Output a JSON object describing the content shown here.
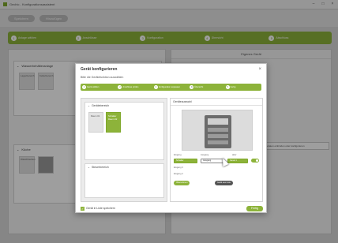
{
  "app": {
    "title": "Gechic - Konfigurationsassistent",
    "toolbar": [
      "Speichern",
      "Hinzufügen"
    ]
  },
  "wizard": {
    "steps": [
      {
        "num": "1",
        "label": "Anlage wählen"
      },
      {
        "num": "2",
        "label": "Anschlüsse"
      },
      {
        "num": "3",
        "label": "Konfiguration"
      },
      {
        "num": "4",
        "label": "Übersicht"
      },
      {
        "num": "5",
        "label": "Abschluss"
      }
    ]
  },
  "background": {
    "left_section1": "Wasserbehälteranlage",
    "left_section1_tiles": [
      "Lagerbereich",
      "Kellerbereich"
    ],
    "left_section2": "Küche",
    "left_section2_tiles": [
      "Waschbecken",
      ""
    ],
    "right_title": "Eigenes Gerät",
    "side_box": "Gerätedaten einbinden oder konfigurieren"
  },
  "dialog": {
    "title": "Gerät konfigurieren",
    "subtitle": "Bitte die Gerätefunktion auswählen",
    "steps": [
      {
        "num": "1",
        "label": "Gerät wählen"
      },
      {
        "num": "2",
        "label": "Anschluss prüfen"
      },
      {
        "num": "3",
        "label": "Konfiguration anpassen"
      },
      {
        "num": "4",
        "label": "Übersicht"
      },
      {
        "num": "5",
        "label": "Fertig"
      }
    ],
    "left_group1_title": "Gerätebereich",
    "left_group1_tiles": [
      {
        "label": "Raum 01"
      },
      {
        "label": "Schalter Raum 02"
      }
    ],
    "left_group2_title": "Steuerbereich",
    "right_title": "Geräteauswahl",
    "fields": {
      "eingang_label": "Eingang",
      "ausgang_label": "Ausgang",
      "aktiv_label": "aktiv",
      "sel1": "Schalter",
      "sel2": "Ausgang",
      "sel3": "Kanal 1",
      "label4": "Eingang 3",
      "label5": "Eingang 4"
    },
    "pills": [
      "Übernehmen",
      "Gerät aus Liste"
    ],
    "checkbox_label": "Gerät in Liste speichern",
    "confirm": "Fertig"
  }
}
